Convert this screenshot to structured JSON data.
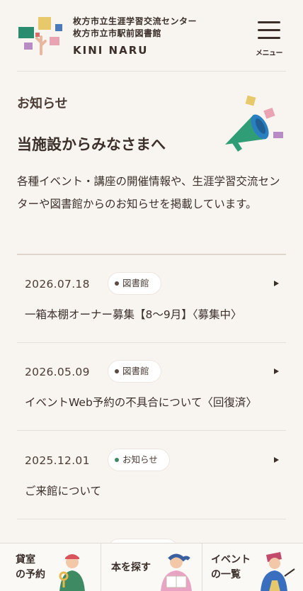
{
  "header": {
    "org_line1": "枚方市立生涯学習交流センター",
    "org_line2": "枚方市立市駅前図書館",
    "brand": "KINI NARU",
    "menu_label": "メニュー"
  },
  "intro": {
    "section_label": "お知らせ",
    "headline": "当施設からみなさまへ",
    "description": "各種イベント・講座の開催情報や、生涯学習交流センターや図書館からのお知らせを掲載しています。"
  },
  "news": [
    {
      "date": "2026.07.18",
      "category": "図書館",
      "title": "一箱本棚オーナー募集【8～9月】〈募集中〉"
    },
    {
      "date": "2026.05.09",
      "category": "図書館",
      "title": "イベントWeb予約の不具合について〈回復済〉"
    },
    {
      "date": "2025.12.01",
      "category": "お知らせ",
      "title": "ご来館について"
    },
    {
      "date": "",
      "category": "",
      "title": ""
    }
  ],
  "bottom_nav": [
    {
      "label": "貸室\nの予約",
      "icon": "person-with-key-icon"
    },
    {
      "label": "本を探す",
      "icon": "person-reading-book-icon"
    },
    {
      "label": "イベント\nの一覧",
      "icon": "person-pointing-icon"
    }
  ],
  "colors": {
    "background": "#f8f5f1",
    "text": "#3b2f2a",
    "notice_dot": "#3d8a63",
    "library_dot": "#5a4a42",
    "megaphone": "#2f9e77"
  }
}
